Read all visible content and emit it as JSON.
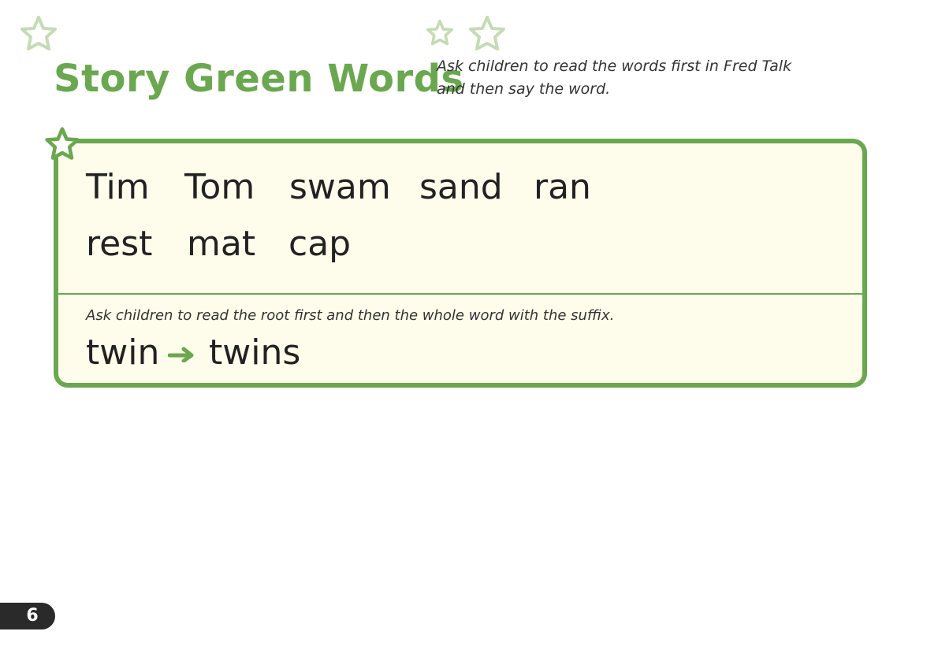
{
  "heading": {
    "title": "Story Green Words",
    "instruction_line1": "Ask children to read the words first in Fred Talk",
    "instruction_line2": "and then say the word."
  },
  "words": {
    "row1": [
      "Tim",
      "Tom",
      "swam",
      "sand",
      "ran"
    ],
    "row2": [
      "rest",
      "mat",
      "cap"
    ]
  },
  "suffix": {
    "instruction": "Ask children to read the root first and then the whole word with the suffix.",
    "root": "twin",
    "word": "twins"
  },
  "page_number": "6",
  "colors": {
    "accent": "#6aa84f",
    "card_background": "#fefdeb",
    "faded_star": "#c4dcb4",
    "page_tab": "#2a2a2a"
  },
  "icons": [
    "star-icon",
    "arrow-right-icon"
  ]
}
